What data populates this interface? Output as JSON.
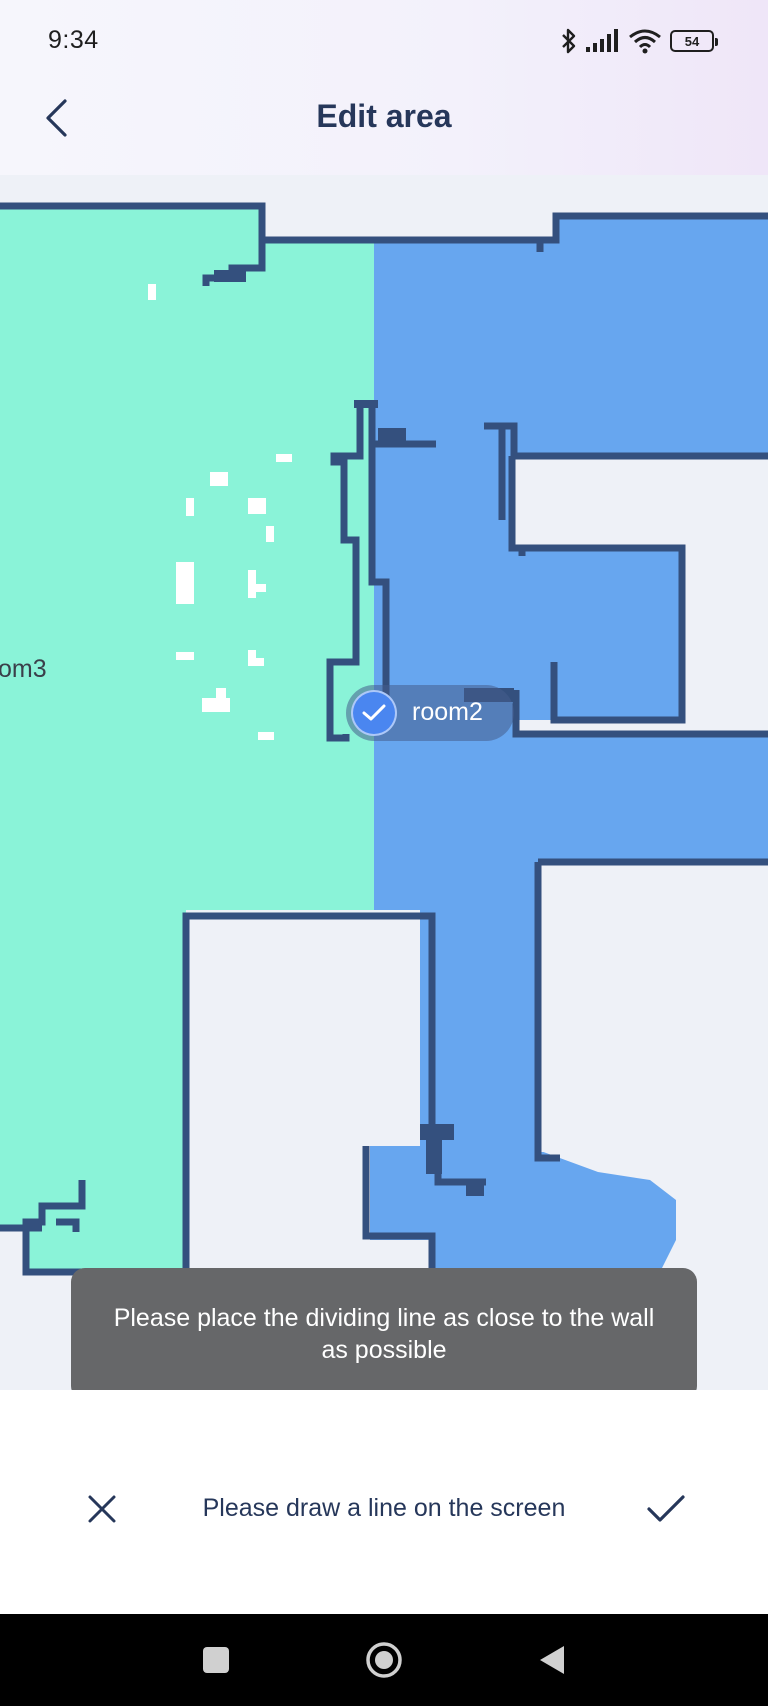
{
  "status_bar": {
    "time": "9:34",
    "battery": "54",
    "icons": [
      "bluetooth-icon",
      "signal-icon",
      "wifi-icon",
      "battery-icon"
    ]
  },
  "header": {
    "title": "Edit area",
    "back_icon": "chevron-left-icon"
  },
  "map": {
    "rooms": [
      {
        "label": "om3",
        "color": "#8af3d8"
      },
      {
        "label": "room2",
        "color": "#67a6ef",
        "selected": true
      }
    ],
    "wall_color": "#34507e",
    "floor_color": "#eef1f7"
  },
  "toast": {
    "message": "Please place the dividing line as close to the wall as possible"
  },
  "action_bar": {
    "hint": "Please draw a line on the screen",
    "cancel_icon": "close-icon",
    "confirm_icon": "check-icon"
  },
  "nav_bar": {
    "icons": [
      "recents-square-icon",
      "home-circle-icon",
      "back-triangle-icon"
    ]
  }
}
